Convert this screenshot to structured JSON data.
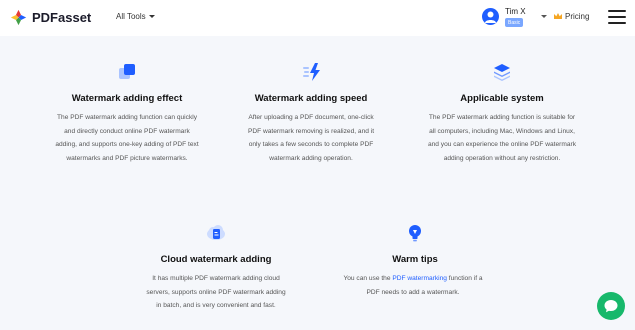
{
  "header": {
    "brand": "PDFasset",
    "tools_label": "All Tools",
    "user_name": "Tim X",
    "plan_badge": "Basic",
    "pricing_label": "Pricing"
  },
  "features": [
    {
      "icon": "layers-square-icon",
      "title": "Watermark adding effect",
      "desc": "The PDF watermark adding function can quickly and directly conduct online PDF watermark adding, and supports one-key adding of PDF text watermarks and PDF picture watermarks."
    },
    {
      "icon": "lightning-icon",
      "title": "Watermark adding speed",
      "desc": "After uploading a PDF document, one-click PDF watermark removing is realized, and it only takes a few seconds to complete PDF watermark adding operation."
    },
    {
      "icon": "stack-icon",
      "title": "Applicable system",
      "desc": "The PDF watermark adding function is suitable for all computers, including Mac, Windows and Linux, and you can experience the online PDF watermark adding operation without any restriction."
    },
    {
      "icon": "cloud-file-icon",
      "title": "Cloud watermark adding",
      "desc": "It has multiple PDF watermark adding cloud servers, supports online PDF watermark adding in batch, and is very convenient and fast."
    },
    {
      "icon": "lightbulb-icon",
      "title": "Warm tips",
      "desc_before": "You can use the ",
      "desc_link": "PDF watermarking",
      "desc_after": " function if a PDF needs to add a watermark."
    }
  ],
  "colors": {
    "accent": "#1f5eff",
    "chat": "#17b86b",
    "background": "#f5f7fb"
  }
}
